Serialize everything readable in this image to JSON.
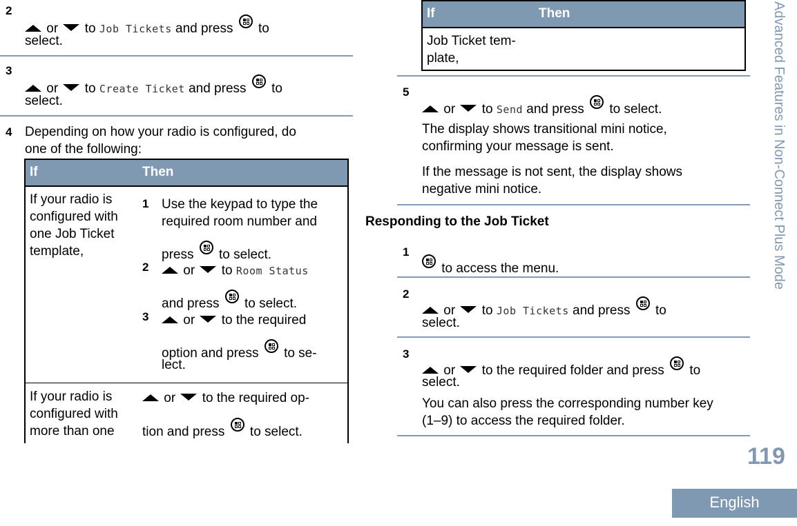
{
  "left_column": {
    "steps": [
      {
        "number": "2",
        "pre": "or",
        "mid": "to",
        "menu_item": "Job Tickets",
        "post": "and press",
        "end": "to",
        "line2": "select."
      },
      {
        "number": "3",
        "pre": "or",
        "mid": "to",
        "menu_item": "Create Ticket",
        "post": "and press",
        "end": "to",
        "line2": "select."
      },
      {
        "number": "4",
        "line1": "Depending on how your radio is configured, do",
        "line2": "one of the following:"
      }
    ],
    "table": {
      "headers": {
        "if": "If",
        "then": "Then"
      },
      "rows": [
        {
          "if_lines": [
            "If your radio is",
            "configured with",
            "one Job Ticket",
            "template,"
          ],
          "then_steps": [
            {
              "number": "1",
              "l1": "Use the keypad to type the",
              "l2": "required room number and",
              "l3a": "press",
              "l3b": "to select."
            },
            {
              "number": "2",
              "or": "or",
              "to": "to",
              "menu_item": "Room Status",
              "l2a": "and press",
              "l2b": "to select."
            },
            {
              "number": "3",
              "or": "or",
              "l1": "to the required",
              "l2a": "option and press",
              "l2b": "to se-",
              "l3": "lect."
            }
          ]
        },
        {
          "if_lines": [
            "If your radio is",
            "configured with",
            "more than one"
          ],
          "then": {
            "or": "or",
            "l1": "to the required op-",
            "l2a": "tion and press",
            "l2b": "to select."
          }
        }
      ]
    }
  },
  "right_column": {
    "table_cont": {
      "headers": {
        "if": "If",
        "then": "Then"
      },
      "if_lines": [
        "Job Ticket tem-",
        "plate,"
      ]
    },
    "step5": {
      "number": "5",
      "or": "or",
      "to": "to",
      "menu_item": "Send",
      "post": "and press",
      "end": "to select.",
      "para1": [
        "The display shows transitional mini notice,",
        "confirming your message is sent."
      ],
      "para2": [
        "If the message is not sent, the display shows",
        "negative mini notice."
      ]
    },
    "section_heading": "Responding to the Job Ticket",
    "resp_steps": [
      {
        "number": "1",
        "text": "to access the menu."
      },
      {
        "number": "2",
        "or": "or",
        "to": "to",
        "menu_item": "Job Tickets",
        "post": "and press",
        "end": "to",
        "line2": "select."
      },
      {
        "number": "3",
        "or": "or",
        "mid": "to the required folder and press",
        "end": "to",
        "line2": "select.",
        "para": [
          "You can also press the corresponding number key",
          "(1–9) to access the required folder."
        ]
      }
    ]
  },
  "sidebar": {
    "chapter_title": "Advanced Features in Non-Connect Plus Mode",
    "page_number": "119",
    "language_tab": "English"
  },
  "colors": {
    "accent": "#7f99b2",
    "rule": "#8199b2",
    "text": "#000000"
  }
}
